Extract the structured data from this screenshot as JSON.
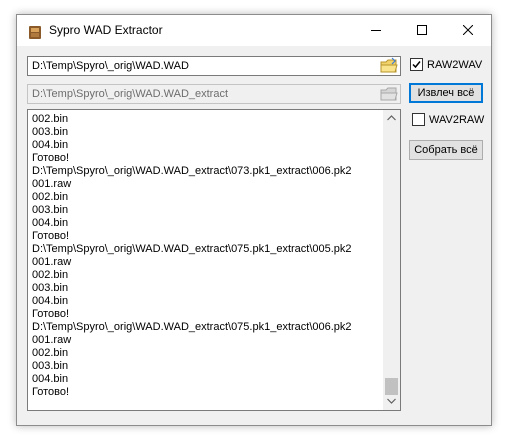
{
  "window": {
    "title": "Sypro WAD Extractor"
  },
  "inputs": {
    "source_path": "D:\\Temp\\Spyro\\_orig\\WAD.WAD",
    "output_path": "D:\\Temp\\Spyro\\_orig\\WAD.WAD_extract"
  },
  "options": {
    "raw2wav": {
      "label": "RAW2WAV",
      "checked": true
    },
    "wav2raw": {
      "label": "WAV2RAW",
      "checked": false
    }
  },
  "buttons": {
    "extract_all": "Извлеч всё",
    "collect_all": "Собрать всё"
  },
  "log": {
    "lines": [
      "002.bin",
      "003.bin",
      "004.bin",
      "Готово!",
      "D:\\Temp\\Spyro\\_orig\\WAD.WAD_extract\\073.pk1_extract\\006.pk2",
      "001.raw",
      "002.bin",
      "003.bin",
      "004.bin",
      "Готово!",
      "D:\\Temp\\Spyro\\_orig\\WAD.WAD_extract\\075.pk1_extract\\005.pk2",
      "001.raw",
      "002.bin",
      "003.bin",
      "004.bin",
      "Готово!",
      "D:\\Temp\\Spyro\\_orig\\WAD.WAD_extract\\075.pk1_extract\\006.pk2",
      "001.raw",
      "002.bin",
      "003.bin",
      "004.bin",
      "Готово!"
    ]
  },
  "icons": {
    "app": "box-icon",
    "browse": "folder-icon",
    "browse_disabled": "folder-disabled-icon",
    "minimize": "minimize-icon",
    "maximize": "maximize-icon",
    "close": "close-icon"
  },
  "colors": {
    "window_bg": "#f0f0f0",
    "default_button_border": "#0078d7",
    "button_bg": "#e1e1e1",
    "disabled_text": "#6d6d6d"
  }
}
